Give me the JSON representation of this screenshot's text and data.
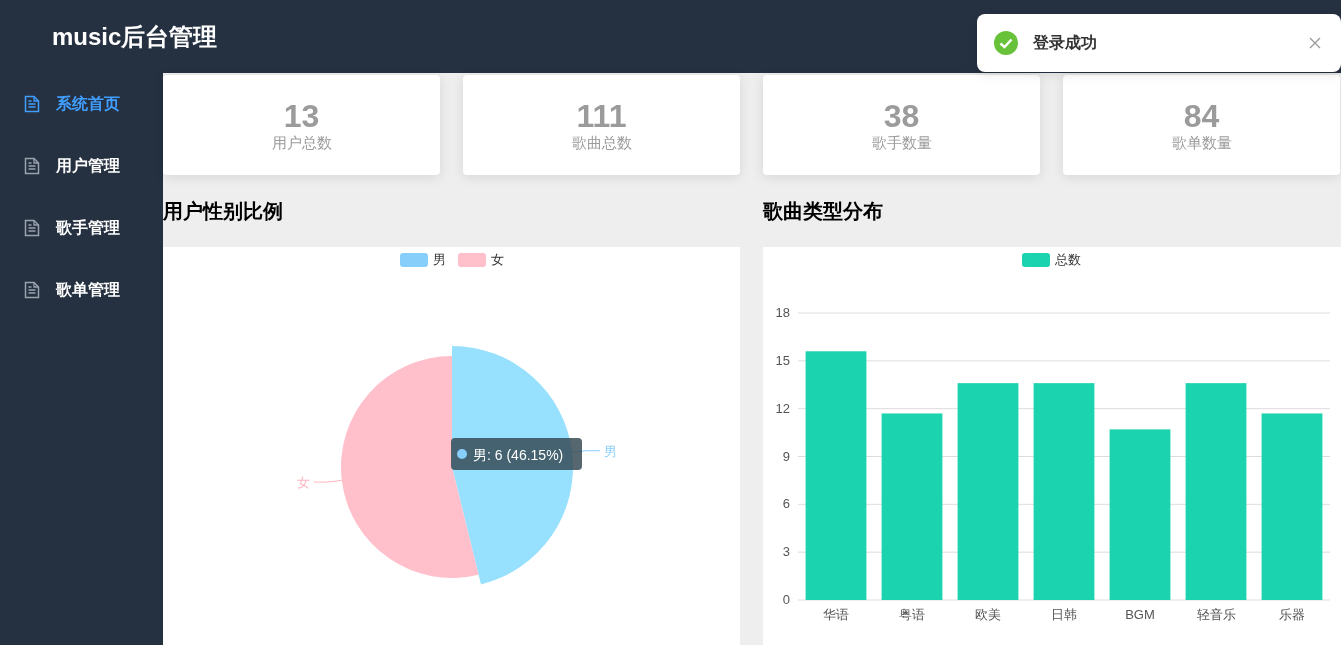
{
  "header": {
    "title": "music后台管理"
  },
  "toast": {
    "kind": "success",
    "message": "登录成功"
  },
  "sidebar": {
    "items": [
      {
        "label": "系统首页",
        "selected": true
      },
      {
        "label": "用户管理",
        "selected": false
      },
      {
        "label": "歌手管理",
        "selected": false
      },
      {
        "label": "歌单管理",
        "selected": false
      }
    ]
  },
  "stats": [
    {
      "value": "13",
      "label": "用户总数"
    },
    {
      "value": "111",
      "label": "歌曲总数"
    },
    {
      "value": "38",
      "label": "歌手数量"
    },
    {
      "value": "84",
      "label": "歌单数量"
    }
  ],
  "gender_chart": {
    "tooltip": "男: 6 (46.15%)",
    "chart_data": {
      "type": "pie",
      "title": "用户性别比例",
      "categories": [
        "男",
        "女"
      ],
      "values": [
        46.15,
        53.85
      ]
    }
  },
  "genre_chart": {
    "chart_data": {
      "type": "bar",
      "title": "歌曲类型分布",
      "categories": [
        "华语",
        "粤语",
        "欧美",
        "日韩",
        "BGM",
        "轻音乐",
        "乐器"
      ],
      "series": [
        {
          "name": "总数",
          "color": "#1cd3b0",
          "values": [
            15.6,
            11.7,
            13.6,
            13.6,
            10.7,
            13.6,
            11.7
          ]
        }
      ],
      "ylim": [
        0,
        18
      ],
      "yticks": [
        0,
        3,
        6,
        9,
        12,
        15,
        18
      ],
      "grid": true
    }
  }
}
